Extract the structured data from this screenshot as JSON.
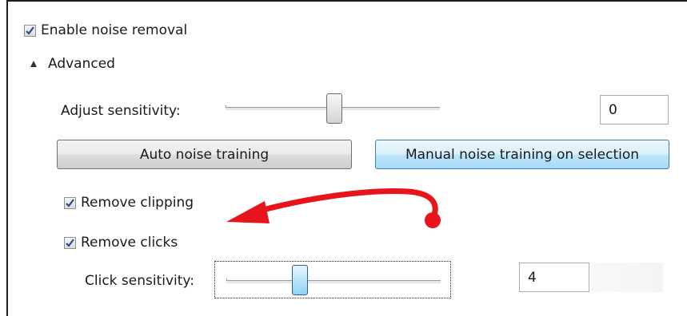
{
  "noise_removal": {
    "enable_label": "Enable noise removal",
    "enabled": true
  },
  "advanced": {
    "label": "Advanced",
    "expanded": true
  },
  "sensitivity": {
    "label": "Adjust sensitivity:",
    "value": "0"
  },
  "buttons": {
    "auto_training": "Auto noise training",
    "manual_training": "Manual noise training on selection"
  },
  "clipping": {
    "label": "Remove clipping",
    "checked": true
  },
  "clicks": {
    "label": "Remove clicks",
    "checked": true
  },
  "click_sensitivity": {
    "label": "Click sensitivity:",
    "value": "4"
  },
  "annotation": {
    "arrow_color": "#e8141c"
  },
  "icons": {
    "check": "check-icon",
    "expand": "triangle-expanded-icon"
  }
}
